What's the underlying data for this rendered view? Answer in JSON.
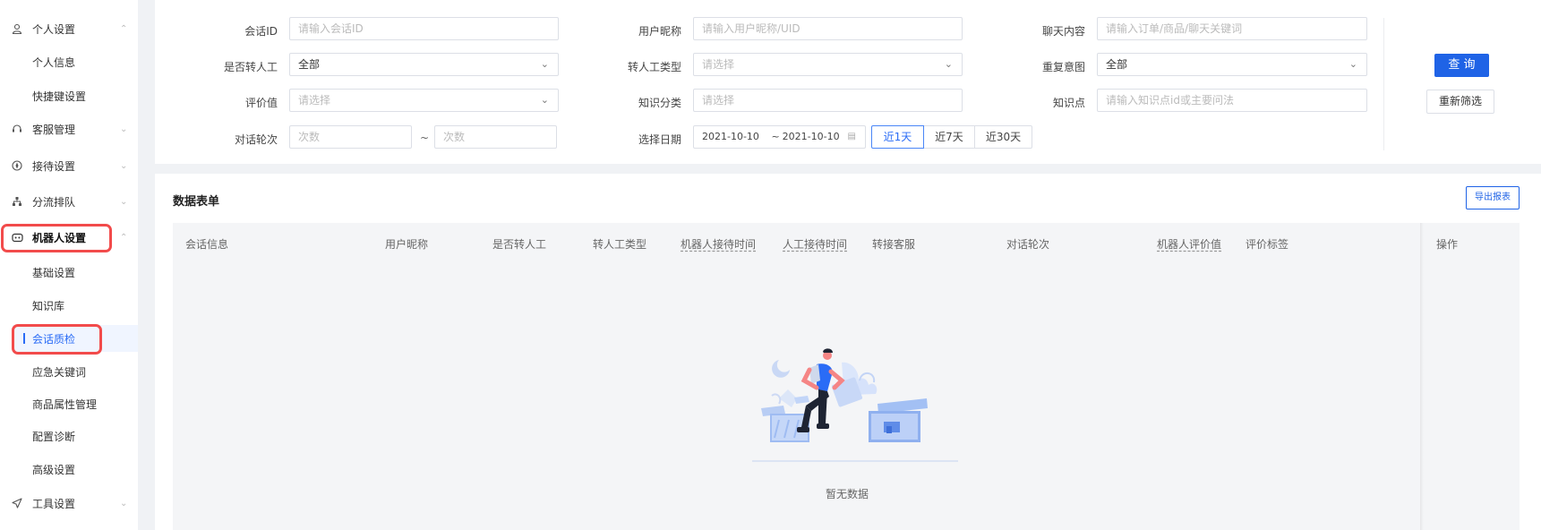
{
  "sidebar": {
    "groups": [
      {
        "label": "个人设置",
        "icon": "user-icon",
        "chevron": "⌃"
      },
      {
        "label": "个人信息"
      },
      {
        "label": "快捷键设置"
      },
      {
        "label": "客服管理",
        "icon": "headset-icon",
        "chevron": "⌄"
      },
      {
        "label": "接待设置",
        "icon": "compass-icon",
        "chevron": "⌄"
      },
      {
        "label": "分流排队",
        "icon": "hierarchy-icon",
        "chevron": "⌄"
      },
      {
        "label": "机器人设置",
        "icon": "robot-icon",
        "chevron": "⌃"
      },
      {
        "label": "基础设置"
      },
      {
        "label": "知识库"
      },
      {
        "label": "会话质检"
      },
      {
        "label": "应急关键词"
      },
      {
        "label": "商品属性管理"
      },
      {
        "label": "配置诊断"
      },
      {
        "label": "高级设置"
      },
      {
        "label": "工具设置",
        "icon": "send-icon",
        "chevron": "⌄"
      }
    ]
  },
  "filters": {
    "session_id": {
      "label": "会话ID",
      "placeholder": "请输入会话ID"
    },
    "nickname": {
      "label": "用户昵称",
      "placeholder": "请输入用户昵称/UID"
    },
    "chat_content": {
      "label": "聊天内容",
      "placeholder": "请输入订单/商品/聊天关键词"
    },
    "transfer": {
      "label": "是否转人工",
      "value": "全部"
    },
    "transfer_type": {
      "label": "转人工类型",
      "placeholder": "请选择"
    },
    "repeat_intent": {
      "label": "重复意图",
      "value": "全部"
    },
    "rating": {
      "label": "评价值",
      "placeholder": "请选择"
    },
    "knowledge_category": {
      "label": "知识分类",
      "placeholder": "请选择"
    },
    "knowledge_point": {
      "label": "知识点",
      "placeholder": "请输入知识点id或主要问法"
    },
    "rounds": {
      "label": "对话轮次",
      "from_placeholder": "次数",
      "separator": "~",
      "to_placeholder": "次数"
    },
    "date": {
      "label": "选择日期",
      "start": "2021-10-10",
      "separator": "~",
      "end": "2021-10-10"
    },
    "quick_ranges": [
      "近1天",
      "近7天",
      "近30天"
    ],
    "query_button": "查 询",
    "reset_button": "重新筛选"
  },
  "table": {
    "title": "数据表单",
    "export_button": "导出报表",
    "columns": [
      "会话信息",
      "用户昵称",
      "是否转人工",
      "转人工类型",
      "机器人接待时间",
      "人工接待时间",
      "转接客服",
      "对话轮次",
      "机器人评价值",
      "评价标签",
      "操作"
    ],
    "empty_text": "暂无数据"
  },
  "colors": {
    "accent": "#1f63e6",
    "highlight": "#f24b4b"
  }
}
